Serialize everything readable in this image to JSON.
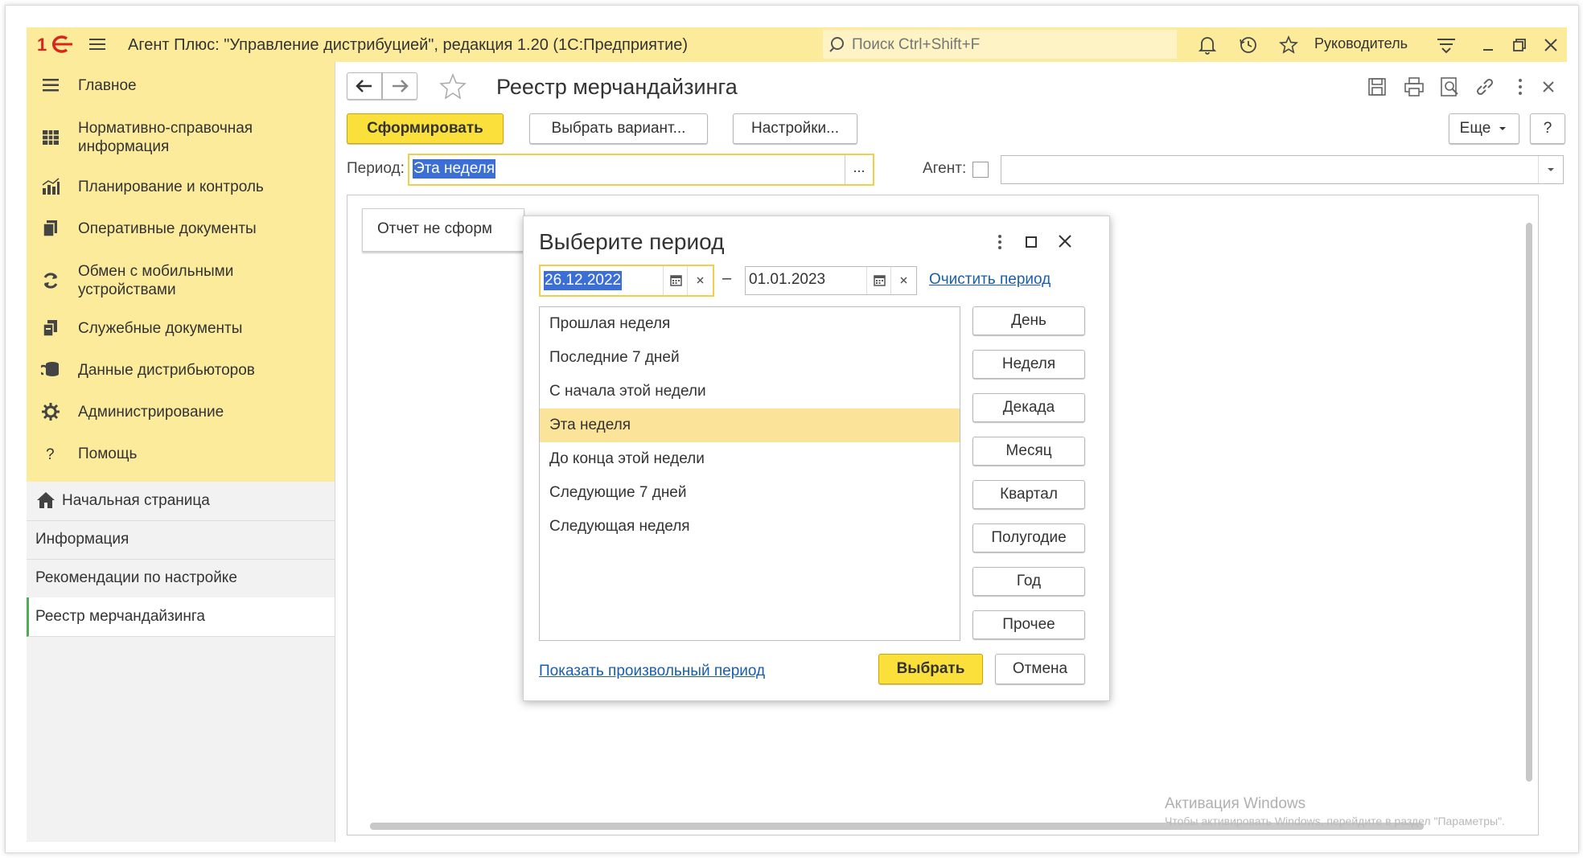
{
  "titlebar": {
    "app_title": "Агент Плюс: \"Управление дистрибуцией\", редакция 1.20  (1С:Предприятие)",
    "search_placeholder": "Поиск Ctrl+Shift+F",
    "user": "Руководитель"
  },
  "sidebar": {
    "sections": [
      {
        "label": "Главное",
        "icon": "hamburger-icon"
      },
      {
        "label": "Нормативно-справочная информация",
        "icon": "grid-icon"
      },
      {
        "label": "Планирование и контроль",
        "icon": "bar-chart-icon"
      },
      {
        "label": "Оперативные документы",
        "icon": "documents-icon"
      },
      {
        "label": "Обмен с мобильными устройствами",
        "icon": "sync-icon"
      },
      {
        "label": "Служебные документы",
        "icon": "service-docs-icon"
      },
      {
        "label": "Данные дистрибьюторов",
        "icon": "database-icon"
      },
      {
        "label": "Администрирование",
        "icon": "gear-icon"
      },
      {
        "label": "Помощь",
        "icon": "question-icon"
      }
    ],
    "open_items": [
      {
        "label": "Начальная страница",
        "icon": "home-icon"
      },
      {
        "label": "Информация"
      },
      {
        "label": "Рекомендации по настройке"
      },
      {
        "label": "Реестр мерчандайзинга",
        "active": true
      }
    ]
  },
  "page": {
    "title": "Реестр мерчандайзинга",
    "generate_button": "Сформировать",
    "select_variant_button": "Выбрать вариант...",
    "settings_button": "Настройки...",
    "more_button": "Еще",
    "help_button": "?",
    "period_label": "Период:",
    "period_value": "Эта неделя",
    "period_ellipsis": "...",
    "agent_label": "Агент:",
    "report_status": "Отчет не сформ"
  },
  "dialog": {
    "title": "Выберите период",
    "date_from": "26.12.2022",
    "date_to": "01.01.2023",
    "dash": "–",
    "clear_link": "Очистить период",
    "presets": [
      "Прошлая неделя",
      "Последние 7 дней",
      "С начала этой недели",
      "Эта неделя",
      "До конца этой недели",
      "Следующие 7 дней",
      "Следующая неделя"
    ],
    "selected_preset": "Эта неделя",
    "granularity_buttons": [
      "День",
      "Неделя",
      "Декада",
      "Месяц",
      "Квартал",
      "Полугодие",
      "Год",
      "Прочее"
    ],
    "custom_period_link": "Показать произвольный период",
    "choose_button": "Выбрать",
    "cancel_button": "Отмена"
  },
  "watermark": {
    "title": "Активация Windows",
    "subtitle": "Чтобы активировать Windows, перейдите в раздел \"Параметры\"."
  },
  "colors": {
    "accent_yellow": "#fbeb9b",
    "primary_button": "#fbe03b",
    "selection": "#fbe49a",
    "link": "#1a5eb0",
    "logo_red": "#d9261c"
  }
}
